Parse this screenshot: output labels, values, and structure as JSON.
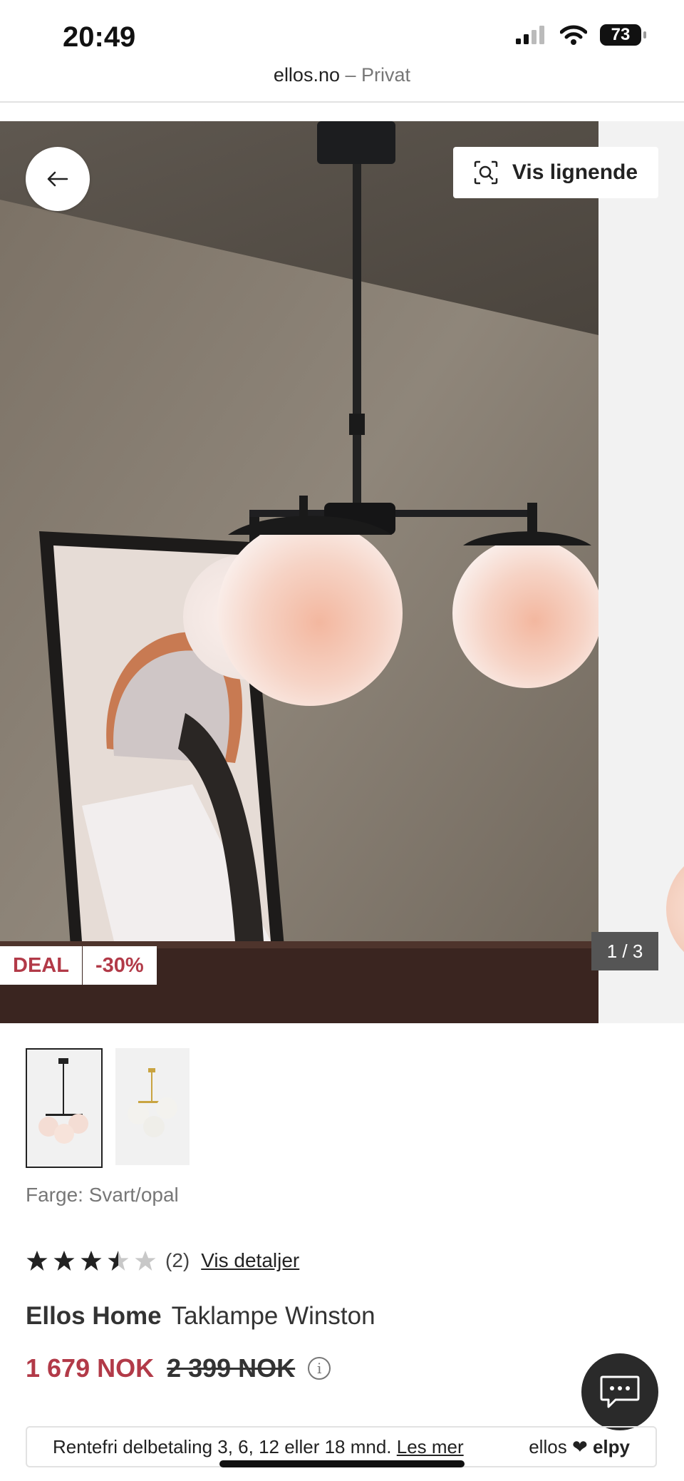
{
  "status_bar": {
    "time": "20:49",
    "battery": "73"
  },
  "browser": {
    "domain": "ellos.no",
    "separator": " – ",
    "mode": "Privat"
  },
  "gallery": {
    "similar_label": "Vis lignende",
    "deal_badge": "DEAL",
    "discount_badge": "-30%",
    "counter": "1 / 3"
  },
  "product": {
    "color_label": "Farge: Svart/opal",
    "rating": 3.5,
    "review_count": "(2)",
    "details_link": "Vis detaljer",
    "brand": "Ellos Home",
    "name": "Taklampe Winston",
    "price_current": "1 679 NOK",
    "price_old": "2 399 NOK"
  },
  "finance": {
    "text": "Rentefri delbetaling 3, 6, 12 eller 18 mnd.",
    "link": "Les mer",
    "logo_left": "ellos",
    "logo_heart": "❤",
    "logo_right": "elpy"
  },
  "colors": {
    "accent": "#b23a48",
    "text": "#222222",
    "muted": "#777777"
  }
}
